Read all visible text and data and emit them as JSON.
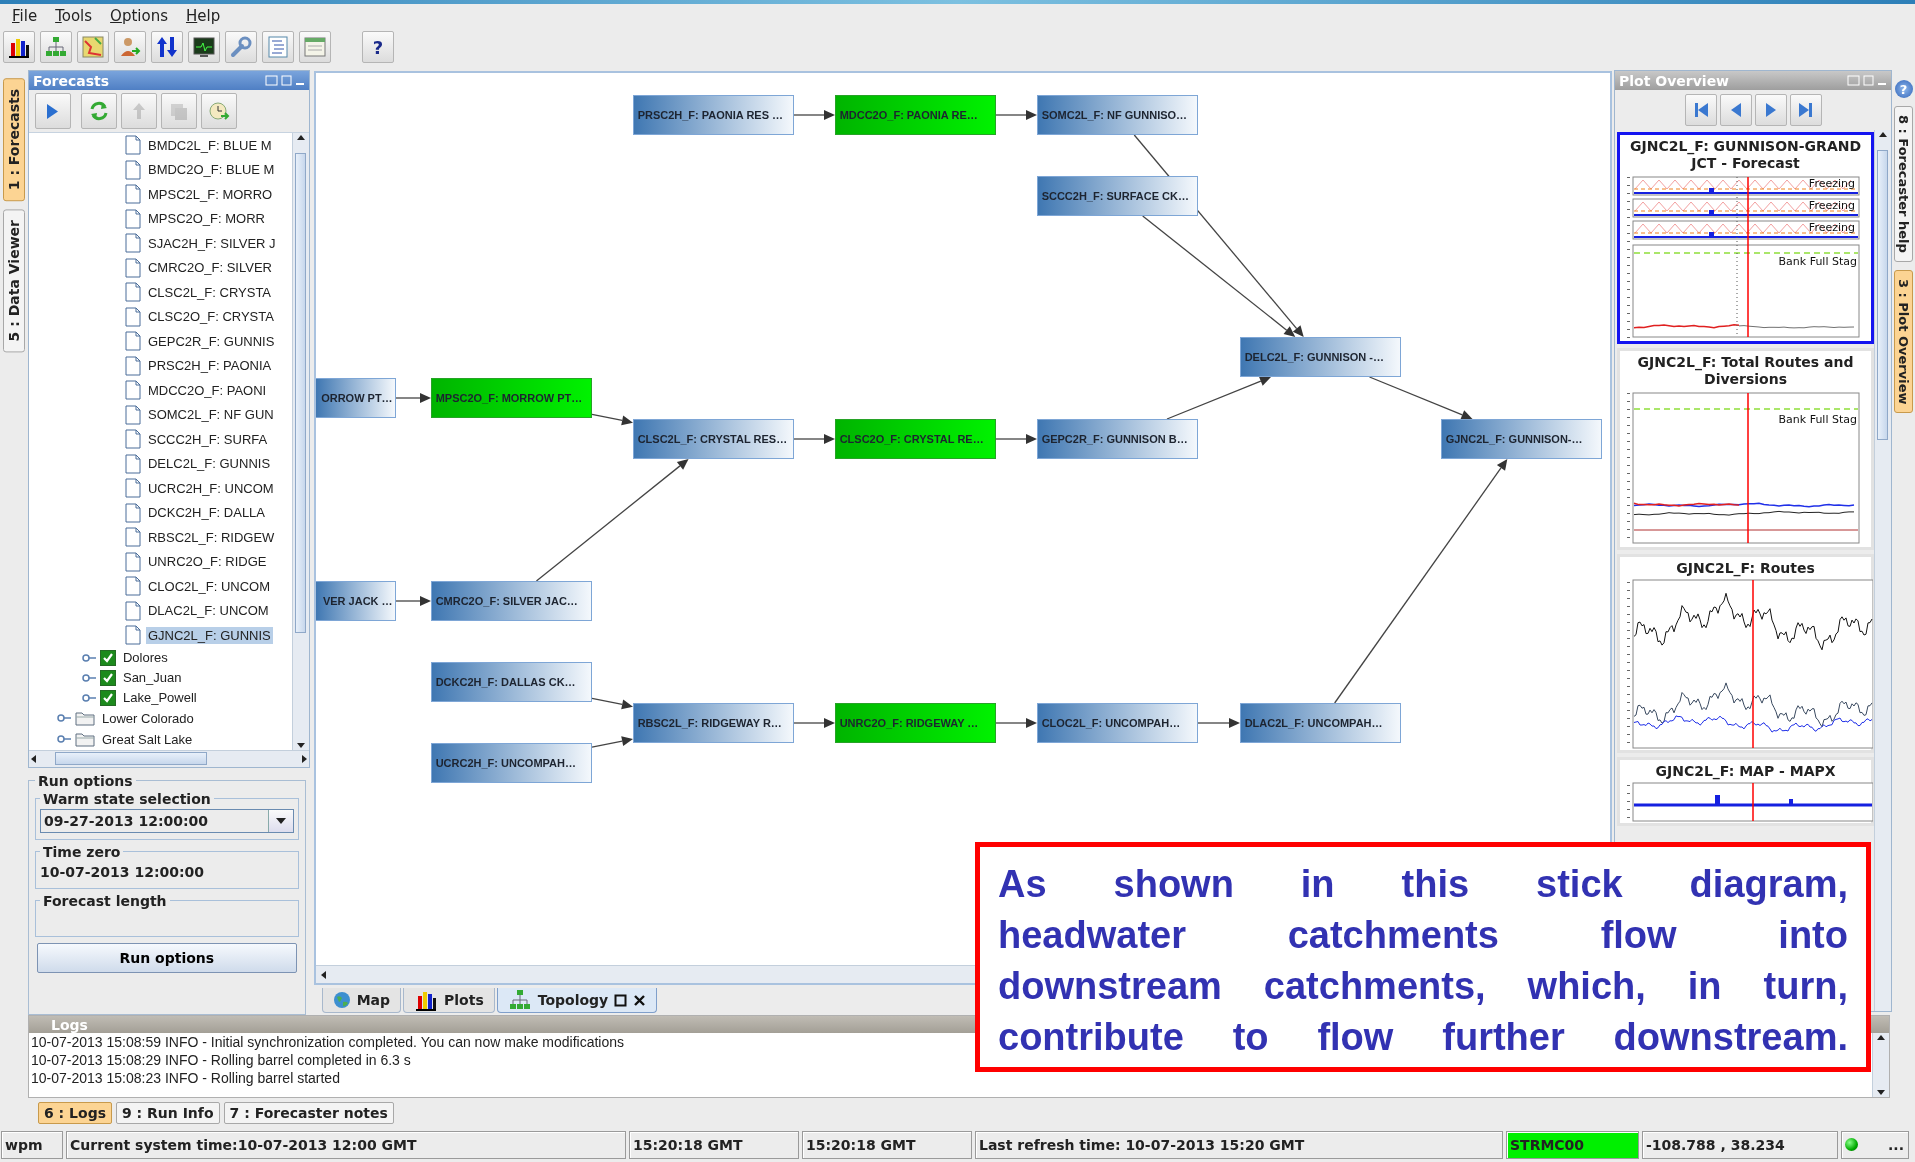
{
  "menu": [
    {
      "label": "File"
    },
    {
      "label": "Tools"
    },
    {
      "label": "Options"
    },
    {
      "label": "Help"
    }
  ],
  "toolbar": {
    "help_button": "?"
  },
  "left_tabs": [
    {
      "label": "1 : Forecasts",
      "selected": true
    },
    {
      "label": "5 : Data Viewer",
      "selected": false
    }
  ],
  "forecasts_panel": {
    "title": "Forecasts",
    "tools": [
      {
        "disabled": false
      },
      {
        "disabled": false
      },
      {
        "disabled": true
      },
      {
        "disabled": true
      },
      {
        "disabled": false
      }
    ],
    "tree": [
      {
        "children": [
          {
            "children": [
              {
                "label": "BMDC2L_F: BLUE M",
                "kind": "file",
                "selected": false
              },
              {
                "label": "BMDC2O_F: BLUE M",
                "kind": "file",
                "selected": false
              },
              {
                "label": "MPSC2L_F: MORRO",
                "kind": "file",
                "selected": false
              },
              {
                "label": "MPSC2O_F: MORR",
                "kind": "file",
                "selected": false
              },
              {
                "label": "SJAC2H_F: SILVER J",
                "kind": "file",
                "selected": false
              },
              {
                "label": "CMRC2O_F: SILVER",
                "kind": "file",
                "selected": false
              },
              {
                "label": "CLSC2L_F: CRYSTA",
                "kind": "file",
                "selected": false
              },
              {
                "label": "CLSC2O_F: CRYSTA",
                "kind": "file",
                "selected": false
              },
              {
                "label": "GEPC2R_F: GUNNIS",
                "kind": "file",
                "selected": false
              },
              {
                "label": "PRSC2H_F: PAONIA",
                "kind": "file",
                "selected": false
              },
              {
                "label": "MDCC2O_F: PAONI",
                "kind": "file",
                "selected": false
              },
              {
                "label": "SOMC2L_F: NF GUN",
                "kind": "file",
                "selected": false
              },
              {
                "label": "SCCC2H_F: SURFA",
                "kind": "file",
                "selected": false
              },
              {
                "label": "DELC2L_F: GUNNIS",
                "kind": "file",
                "selected": false
              },
              {
                "label": "UCRC2H_F: UNCOM",
                "kind": "file",
                "selected": false
              },
              {
                "label": "DCKC2H_F: DALLA",
                "kind": "file",
                "selected": false
              },
              {
                "label": "RBSC2L_F: RIDGEW",
                "kind": "file",
                "selected": false
              },
              {
                "label": "UNRC2O_F: RIDGE",
                "kind": "file",
                "selected": false
              },
              {
                "label": "CLOC2L_F: UNCOM",
                "kind": "file",
                "selected": false
              },
              {
                "label": "DLAC2L_F: UNCOM",
                "kind": "file",
                "selected": false
              },
              {
                "label": "GJNC2L_F: GUNNIS",
                "kind": "file",
                "selected": true
              }
            ]
          },
          {
            "label": "Dolores",
            "kind": "checkbox",
            "checked": true,
            "expanded": false
          },
          {
            "label": "San_Juan",
            "kind": "checkbox",
            "checked": true,
            "expanded": false
          },
          {
            "label": "Lake_Powell",
            "kind": "checkbox",
            "checked": true,
            "expanded": false
          }
        ]
      },
      {
        "label": "Lower Colorado",
        "kind": "folder",
        "expanded": false
      },
      {
        "label": "Great Salt Lake",
        "kind": "folder",
        "expanded": false
      }
    ]
  },
  "run_options": {
    "title": "Run options",
    "warm_state": {
      "label": "Warm state selection",
      "value": "09-27-2013 12:00:00"
    },
    "time_zero": {
      "label": "Time zero",
      "value": "10-07-2013 12:00:00"
    },
    "forecast_length": {
      "label": "Forecast length"
    },
    "button": "Run options"
  },
  "topology": {
    "nodes": [
      {
        "label": "GJNC2L_F: GUNNISON-…",
        "highlighted": false,
        "children": [
          {
            "label": "DELC2L_F: GUNNISON -…",
            "highlighted": false,
            "children": [
              {
                "label": "SOMC2L_F: NF GUNNISO…",
                "highlighted": false,
                "children": [
                  {
                    "label": "MDCC2O_F: PAONIA RE…",
                    "highlighted": true,
                    "children": [
                      {
                        "label": "PRSC2H_F: PAONIA RES …",
                        "highlighted": false
                      }
                    ]
                  }
                ]
              },
              {
                "label": "SCCC2H_F: SURFACE CK…",
                "highlighted": false
              },
              {
                "label": "GEPC2R_F: GUNNISON B…",
                "highlighted": false,
                "children": [
                  {
                    "label": "CLSC2O_F: CRYSTAL RE…",
                    "highlighted": true,
                    "children": [
                      {
                        "label": "CLSC2L_F: CRYSTAL RES…",
                        "highlighted": false,
                        "children": [
                          {
                            "label": "MPSC2O_F: MORROW PT…",
                            "highlighted": true,
                            "children": [
                              {
                                "label": "ORROW PT…",
                                "highlighted": false
                              }
                            ]
                          },
                          {
                            "label": "CMRC2O_F: SILVER JAC…",
                            "highlighted": false,
                            "children": [
                              {
                                "label": "VER JACK …",
                                "highlighted": false
                              }
                            ]
                          }
                        ]
                      }
                    ]
                  }
                ]
              }
            ]
          },
          {
            "label": "DLAC2L_F: UNCOMPAH…",
            "highlighted": false,
            "children": [
              {
                "label": "CLOC2L_F: UNCOMPAH…",
                "highlighted": false,
                "children": [
                  {
                    "label": "UNRC2O_F: RIDGEWAY …",
                    "highlighted": true,
                    "children": [
                      {
                        "label": "RBSC2L_F: RIDGEWAY R…",
                        "highlighted": false,
                        "children": [
                          {
                            "label": "DCKC2H_F: DALLAS CK…",
                            "highlighted": false
                          },
                          {
                            "label": "UCRC2H_F: UNCOMPAH…",
                            "highlighted": false
                          }
                        ]
                      }
                    ]
                  }
                ]
              }
            ]
          }
        ]
      }
    ]
  },
  "view_tabs": [
    {
      "label": "Map",
      "kind": "map",
      "selected": false,
      "closable": false
    },
    {
      "label": "Plots",
      "kind": "plots",
      "selected": false,
      "closable": false
    },
    {
      "label": "Topology",
      "kind": "topology",
      "selected": true,
      "closable": true
    }
  ],
  "plot_overview": {
    "title": "Plot Overview",
    "plots": [
      {
        "title": "GJNC2L_F: GUNNISON-GRAND JCT - Forecast",
        "kind": "forecast",
        "selected": true,
        "labels": [
          "Freezing",
          "Freezing",
          "Freezing",
          "Bank Full Stag"
        ]
      },
      {
        "title": "GJNC2L_F: Total Routes and Diversions",
        "kind": "totals",
        "selected": false,
        "labels": [
          "Bank Full Stag"
        ]
      },
      {
        "title": "GJNC2L_F: Routes",
        "kind": "routes",
        "selected": false
      },
      {
        "title": "GJNC2L_F: MAP - MAPX",
        "kind": "map",
        "selected": false
      }
    ]
  },
  "right_tabs": {
    "help_button": "?",
    "tabs": [
      {
        "label": "8 : Forecaster help",
        "selected": false
      },
      {
        "label": "3 : Plot Overview",
        "selected": true
      }
    ]
  },
  "logs": {
    "title": "Logs",
    "lines": [
      "10-07-2013 15:08:59 INFO - Initial synchronization completed. You can now make modifications",
      "10-07-2013 15:08:29 INFO - Rolling barrel completed in 6.3 s",
      "10-07-2013 15:08:23 INFO - Rolling barrel started"
    ]
  },
  "bottom_tabs": [
    {
      "label": "6 : Logs",
      "selected": true
    },
    {
      "label": "9 : Run Info",
      "selected": false
    },
    {
      "label": "7 : Forecaster notes",
      "selected": false
    }
  ],
  "status_bar": [
    {
      "text": "wpm",
      "kind": "text"
    },
    {
      "text": "Current system time:10-07-2013 12:00 GMT",
      "kind": "text"
    },
    {
      "text": "15:20:18 GMT",
      "kind": "text"
    },
    {
      "text": "15:20:18 GMT",
      "kind": "text"
    },
    {
      "text": "Last refresh time: 10-07-2013 15:20 GMT",
      "kind": "text"
    },
    {
      "text": "STRMC00",
      "kind": "highlight"
    },
    {
      "text": "-108.788 , 38.234",
      "kind": "text"
    },
    {
      "text": "...",
      "kind": "indicator"
    }
  ],
  "callout": {
    "lines": [
      "As shown in this stick diagram,",
      "headwater catchments flow into",
      "downstream catchments, which, in turn,",
      "contribute to flow further downstream."
    ]
  }
}
